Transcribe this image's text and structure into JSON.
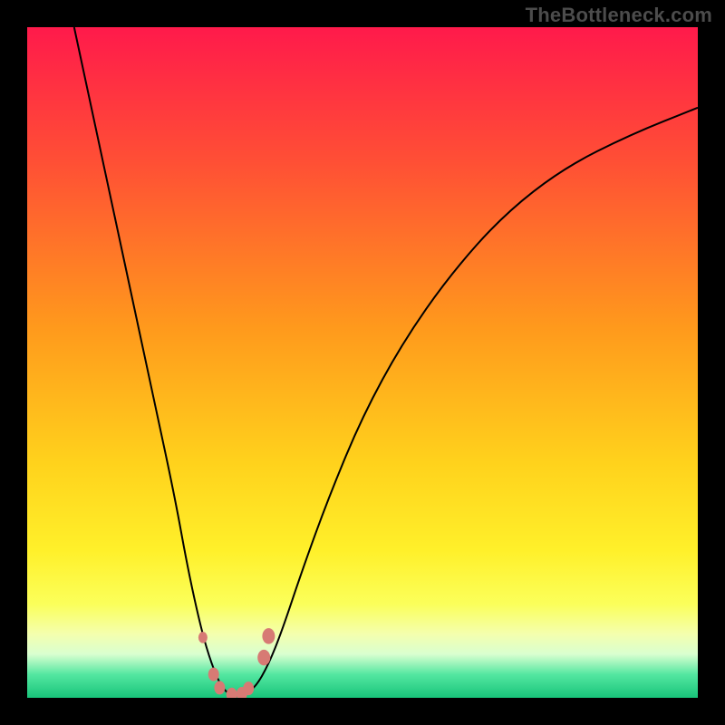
{
  "watermark": {
    "text": "TheBottleneck.com"
  },
  "colors": {
    "page_bg": "#000000",
    "watermark": "#4c4c4c",
    "curve": "#000000",
    "marker": "#d77a74",
    "gradient_stops": [
      {
        "pos": 0.0,
        "color": "#ff1a4b"
      },
      {
        "pos": 0.2,
        "color": "#ff4f35"
      },
      {
        "pos": 0.45,
        "color": "#ff9a1c"
      },
      {
        "pos": 0.65,
        "color": "#ffd21c"
      },
      {
        "pos": 0.78,
        "color": "#fff02a"
      },
      {
        "pos": 0.86,
        "color": "#fbff5a"
      },
      {
        "pos": 0.905,
        "color": "#f4ffae"
      },
      {
        "pos": 0.935,
        "color": "#d9ffd0"
      },
      {
        "pos": 0.965,
        "color": "#54e7a1"
      },
      {
        "pos": 1.0,
        "color": "#18c47a"
      }
    ]
  },
  "chart_data": {
    "type": "line",
    "title": "",
    "xlabel": "",
    "ylabel": "",
    "xlim": [
      0,
      100
    ],
    "ylim": [
      0,
      100
    ],
    "series": [
      {
        "name": "bottleneck-curve",
        "x": [
          7,
          10,
          13,
          16,
          19,
          22,
          24,
          26,
          27.5,
          29,
          30.5,
          32,
          34,
          36,
          38,
          41,
          45,
          50,
          56,
          63,
          71,
          80,
          90,
          100
        ],
        "y": [
          100,
          86,
          72,
          58,
          44,
          30,
          19,
          10,
          5,
          1.5,
          0.3,
          0.3,
          1.5,
          5,
          10,
          19,
          30,
          42,
          53,
          63,
          72,
          79,
          84,
          88
        ]
      }
    ],
    "markers": [
      {
        "x": 26.2,
        "y": 9.0,
        "r": 5
      },
      {
        "x": 27.8,
        "y": 3.5,
        "r": 6
      },
      {
        "x": 28.7,
        "y": 1.5,
        "r": 6
      },
      {
        "x": 30.5,
        "y": 0.5,
        "r": 6
      },
      {
        "x": 32.0,
        "y": 0.6,
        "r": 6
      },
      {
        "x": 33.0,
        "y": 1.4,
        "r": 6
      },
      {
        "x": 35.3,
        "y": 6.0,
        "r": 7
      },
      {
        "x": 36.0,
        "y": 9.2,
        "r": 7
      }
    ]
  }
}
